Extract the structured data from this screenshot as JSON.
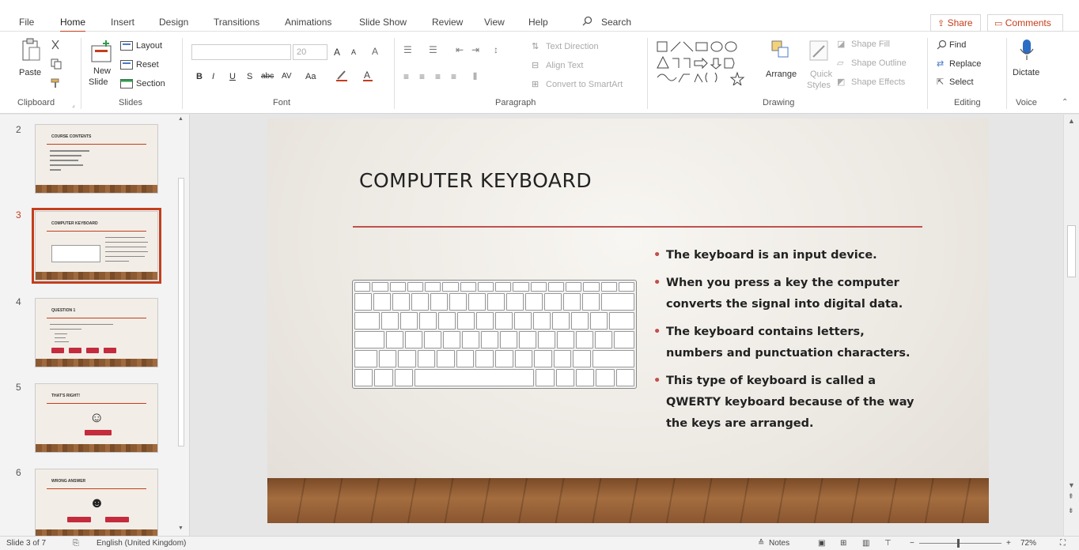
{
  "ribbon_tabs": {
    "file": "File",
    "home": "Home",
    "insert": "Insert",
    "design": "Design",
    "transitions": "Transitions",
    "animations": "Animations",
    "slide_show": "Slide Show",
    "review": "Review",
    "view": "View",
    "help": "Help",
    "search": "Search"
  },
  "header_actions": {
    "share": "Share",
    "comments": "Comments"
  },
  "ribbon": {
    "clipboard": {
      "label": "Clipboard",
      "paste": "Paste"
    },
    "slides": {
      "label": "Slides",
      "new_slide_line1": "New",
      "new_slide_line2": "Slide",
      "layout": "Layout",
      "reset": "Reset",
      "section": "Section"
    },
    "font": {
      "label": "Font",
      "size": "20",
      "bold": "B",
      "italic": "I",
      "underline": "U",
      "strike": "S",
      "abc": "abc",
      "av": "AV",
      "case": "Aa",
      "grow": "A",
      "shrink": "A"
    },
    "paragraph": {
      "label": "Paragraph",
      "text_direction": "Text Direction",
      "align_text": "Align Text",
      "convert_smartart": "Convert to SmartArt"
    },
    "drawing": {
      "label": "Drawing",
      "arrange": "Arrange",
      "quick_styles_line1": "Quick",
      "quick_styles_line2": "Styles",
      "shape_fill": "Shape Fill",
      "shape_outline": "Shape Outline",
      "shape_effects": "Shape Effects"
    },
    "editing": {
      "label": "Editing",
      "find": "Find",
      "replace": "Replace",
      "select": "Select"
    },
    "voice": {
      "label": "Voice",
      "dictate": "Dictate"
    }
  },
  "thumbnails": [
    {
      "number": "2",
      "title": "COURSE CONTENTS"
    },
    {
      "number": "3",
      "title": "COMPUTER KEYBOARD"
    },
    {
      "number": "4",
      "title": "QUESTION 1"
    },
    {
      "number": "5",
      "title": "THAT'S RIGHT!"
    },
    {
      "number": "6",
      "title": "WRONG ANSWER"
    }
  ],
  "slide": {
    "title": "COMPUTER KEYBOARD",
    "bullets": [
      "The keyboard is an input device.",
      "When you press a key the computer converts the signal into digital data.",
      "The keyboard contains letters, numbers and punctuation characters.",
      "This type of keyboard is called a QWERTY keyboard because of the way the keys are arranged."
    ]
  },
  "status_bar": {
    "slide_counter": "Slide 3 of 7",
    "language": "English (United Kingdom)",
    "notes": "Notes",
    "zoom": "72%"
  },
  "colors": {
    "accent": "#c43e1c",
    "title_rule": "#c0504d"
  }
}
